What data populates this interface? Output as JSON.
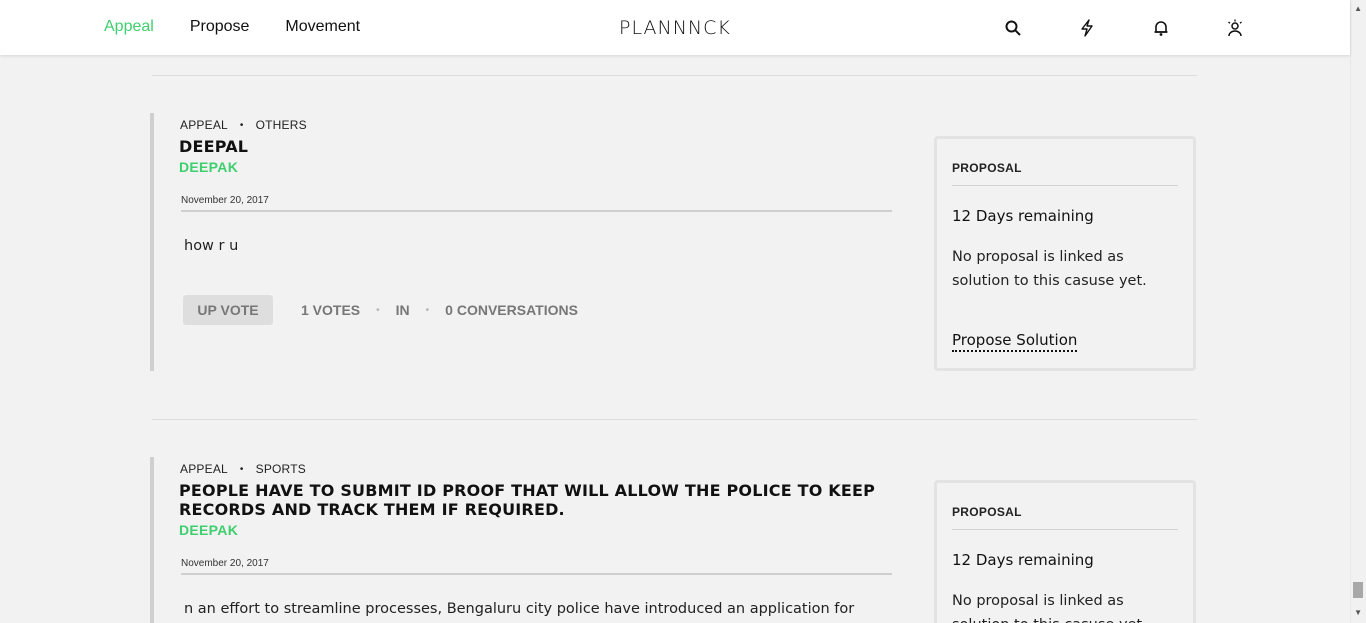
{
  "header": {
    "nav": [
      "Appeal",
      "Propose",
      "Movement"
    ],
    "active_nav": "Appeal",
    "logo": "PLANNNCK",
    "icons": [
      "search-icon",
      "bolt-icon",
      "bell-icon",
      "user-icon"
    ]
  },
  "colors": {
    "accent": "#3ecf6e"
  },
  "cards": [
    {
      "type": "APPEAL",
      "category": "OTHERS",
      "title": "DEEPAL",
      "author": "DEEPAK",
      "date": "November 20, 2017",
      "body": "how r u",
      "upvote_label": "UP VOTE",
      "votes": "1 VOTES",
      "status": "IN",
      "conversations": "0 CONVERSATIONS",
      "proposal": {
        "heading": "PROPOSAL",
        "days": "12 Days remaining",
        "text": "No proposal is linked as solution to this casuse yet.",
        "link": "Propose Solution"
      }
    },
    {
      "type": "APPEAL",
      "category": "SPORTS",
      "title": "PEOPLE HAVE TO SUBMIT ID PROOF THAT WILL ALLOW THE POLICE TO KEEP RECORDS AND TRACK THEM IF REQUIRED.",
      "author": "DEEPAK",
      "date": "November 20, 2017",
      "body": "n an effort to streamline processes, Bengaluru city police have introduced an application for",
      "proposal": {
        "heading": "PROPOSAL",
        "days": "12 Days remaining",
        "text": "No proposal is linked as solution to this casuse yet."
      }
    }
  ]
}
